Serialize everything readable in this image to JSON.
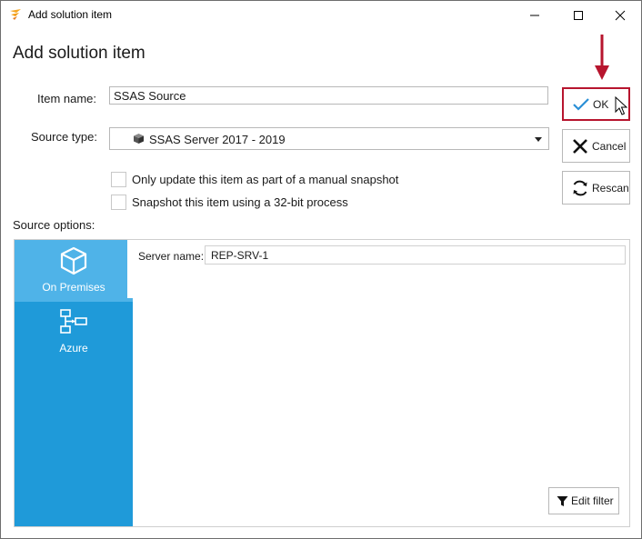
{
  "window": {
    "title": "Add solution item",
    "heading": "Add solution item",
    "controls": {
      "minimize": "minimize-icon",
      "maximize": "maximize-icon",
      "close": "close-icon"
    }
  },
  "form": {
    "item_name_label": "Item name:",
    "item_name_value": "SSAS Source",
    "source_type_label": "Source type:",
    "source_type_value": "SSAS Server 2017 - 2019",
    "checkbox_manual_snapshot": {
      "label": "Only update this item as part of a manual snapshot",
      "checked": false
    },
    "checkbox_32bit": {
      "label": "Snapshot this item using a 32-bit process",
      "checked": false
    },
    "source_options_label": "Source options:"
  },
  "buttons": {
    "ok": "OK",
    "cancel": "Cancel",
    "rescan": "Rescan",
    "edit_filter": "Edit filter"
  },
  "source_nav": {
    "items": [
      {
        "label": "On Premises",
        "icon": "cube-icon",
        "active": true
      },
      {
        "label": "Azure",
        "icon": "azure-network-icon",
        "active": false
      }
    ]
  },
  "server": {
    "label": "Server name:",
    "value": "REP-SRV-1"
  },
  "colors": {
    "nav_bg": "#1f9ad9",
    "nav_active": "#4fb3e8",
    "ok_highlight": "#b7152e",
    "app_icon": "#f5a623"
  }
}
